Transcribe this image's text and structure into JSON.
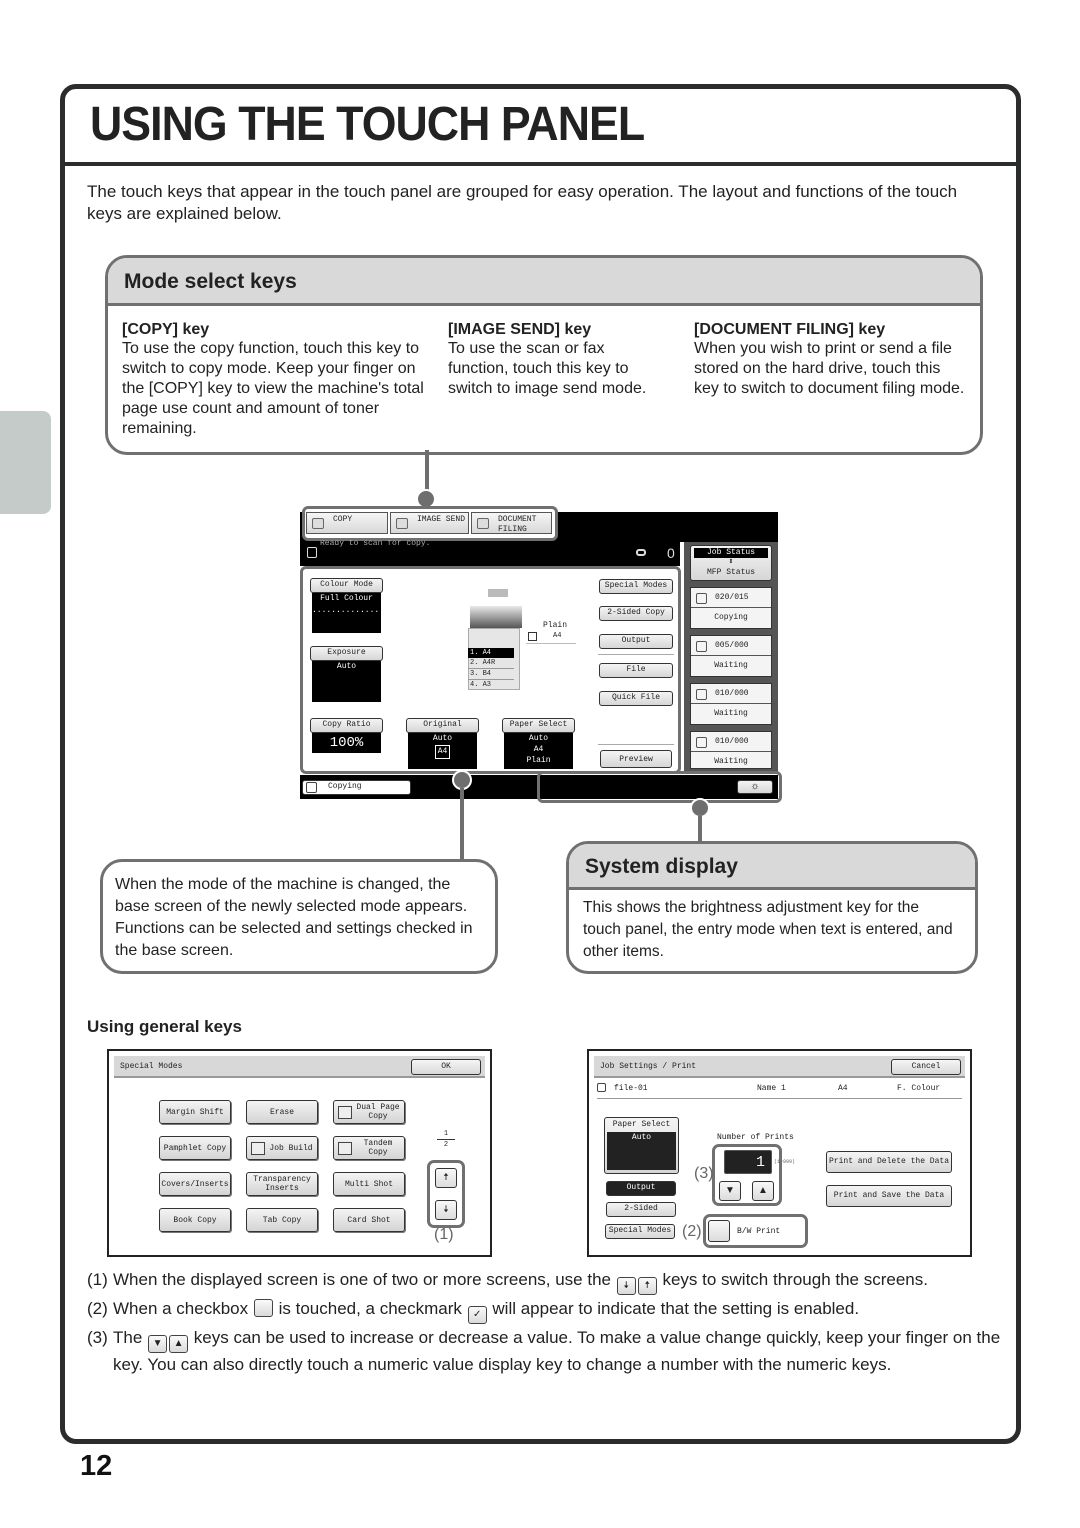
{
  "page": {
    "title": "USING THE TOUCH PANEL",
    "intro": "The touch keys that appear in the touch panel are grouped for easy operation. The layout and functions of the touch keys are explained below.",
    "page_number": "12"
  },
  "mode_select": {
    "heading": "Mode select keys",
    "columns": [
      {
        "title": "[COPY] key",
        "text": "To use the copy function, touch this key to switch to copy mode. Keep your finger on the [COPY] key to view the machine's total page use count and amount of toner remaining."
      },
      {
        "title": "[IMAGE SEND] key",
        "text": "To use the scan or fax function, touch this key to switch to image send mode."
      },
      {
        "title": "[DOCUMENT FILING] key",
        "text": "When you wish to print or send a file stored on the hard drive, touch this key to switch to document filing mode."
      }
    ]
  },
  "touch_panel": {
    "mode_keys": [
      "COPY",
      "IMAGE SEND",
      "DOCUMENT FILING"
    ],
    "status_message": "Ready to scan for copy.",
    "copy_count": "0",
    "colour_mode": {
      "label": "Colour Mode",
      "value": "Full Colour",
      "sub": "..............."
    },
    "exposure": {
      "label": "Exposure",
      "value": "Auto"
    },
    "copy_ratio": {
      "label": "Copy Ratio",
      "value": "100%"
    },
    "original": {
      "label": "Original",
      "value": "Auto",
      "size": "A4"
    },
    "paper_select": {
      "label": "Paper Select",
      "lines": [
        "Auto",
        "A4",
        "Plain"
      ]
    },
    "bypass": {
      "type": "Plain",
      "size": "A4"
    },
    "trays": [
      {
        "num": "1.",
        "size": "A4"
      },
      {
        "num": "2.",
        "size": "A4R"
      },
      {
        "num": "3.",
        "size": "B4"
      },
      {
        "num": "4.",
        "size": "A3"
      }
    ],
    "right_keys": [
      "Special Modes",
      "2-Sided Copy",
      "Output",
      "File",
      "Quick File",
      "Preview"
    ],
    "job_status_toggle": {
      "top": "Job Status",
      "bottom": "MFP Status"
    },
    "jobs": [
      {
        "count": "020/015",
        "status": "Copying"
      },
      {
        "count": "005/000",
        "status": "Waiting"
      },
      {
        "count": "010/000",
        "status": "Waiting"
      },
      {
        "count": "010/000",
        "status": "Waiting"
      }
    ],
    "bottom_status": "Copying"
  },
  "base_screen_callout": {
    "text": "When the mode of the machine is changed, the base screen of the newly selected mode appears. Functions can be selected and settings checked in the base screen."
  },
  "system_display": {
    "heading": "System display",
    "text": "This shows the brightness adjustment key for the touch panel, the entry mode when text is entered, and other items."
  },
  "general_keys": {
    "heading": "Using general keys",
    "special_modes": {
      "title": "Special Modes",
      "ok_label": "OK",
      "keys": [
        "Margin Shift",
        "Erase",
        "Dual Page Copy",
        "Pamphlet Copy",
        "Job Build",
        "Tandem Copy",
        "Covers/Inserts",
        "Transparency Inserts",
        "Multi Shot",
        "Book Copy",
        "Tab Copy",
        "Card Shot"
      ],
      "page_current": "1",
      "page_total": "2",
      "callout_label": "(1)"
    },
    "job_settings": {
      "title": "Job Settings / Print",
      "cancel_label": "Cancel",
      "file": {
        "name": "file-01",
        "user": "Name 1",
        "size": "A4",
        "colour": "F. Colour"
      },
      "paper_select": {
        "label": "Paper Select",
        "value": "Auto"
      },
      "left_keys": [
        "Output",
        "2-Sided",
        "Special Modes"
      ],
      "number_of_prints": {
        "label": "Number of Prints",
        "value": "1",
        "range": "(1~999)"
      },
      "checkbox_label": "B/W Print",
      "actions": [
        "Print and Delete the Data",
        "Print and Save the Data"
      ],
      "callout_labels": [
        "(3)",
        "(2)"
      ]
    }
  },
  "notes": [
    {
      "num": "(1)",
      "before": "When the displayed screen is one of two or more screens, use the",
      "after": "keys to switch through the screens."
    },
    {
      "num": "(2)",
      "before": "When a checkbox",
      "middle": "is touched, a checkmark",
      "after": "will appear to indicate that the setting is enabled."
    },
    {
      "num": "(3)",
      "before": "The",
      "after": "keys can be used to increase or decrease a value. To make a value change quickly, keep your finger on the key. You can also directly touch a numeric value display key to change a number with the numeric keys."
    }
  ]
}
